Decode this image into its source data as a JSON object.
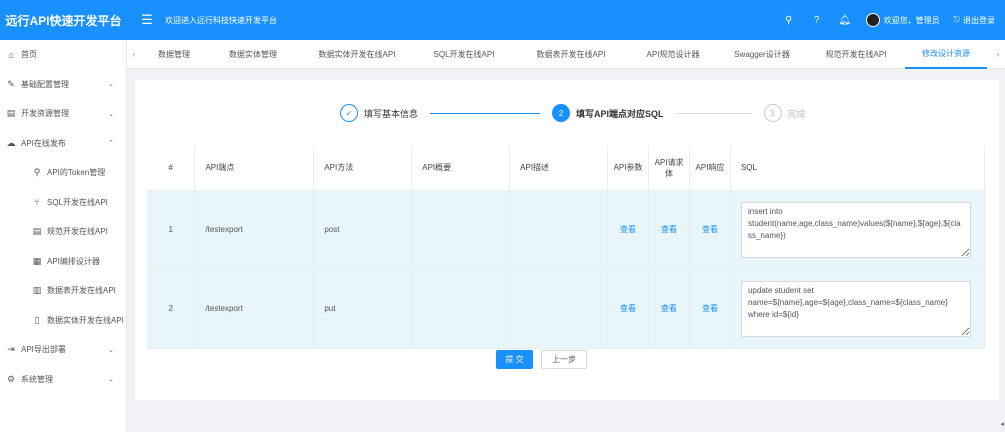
{
  "header": {
    "brand": "远行API快速开发平台",
    "welcome": "欢迎进入远行科技快速开发平台",
    "user_greeting": "欢迎您，管理员",
    "logout": "退出登录",
    "menu_icon": "hamburger-icon",
    "search_icon": "search-icon",
    "help_icon": "help-icon",
    "bell_icon": "bell-icon"
  },
  "sidebar": {
    "items": [
      {
        "label": "首页",
        "icon": "home-icon",
        "sub": false,
        "arrow": ""
      },
      {
        "label": "基础配置管理",
        "icon": "wrench-icon",
        "sub": false,
        "arrow": "⌄"
      },
      {
        "label": "开发资源管理",
        "icon": "document-icon",
        "sub": false,
        "arrow": "⌄"
      },
      {
        "label": "API在线发布",
        "icon": "cloud-icon",
        "sub": false,
        "arrow": "⌃"
      },
      {
        "label": "API的Token管理",
        "icon": "key-icon",
        "sub": true,
        "arrow": ""
      },
      {
        "label": "SQL开发在线API",
        "icon": "fork-icon",
        "sub": true,
        "arrow": ""
      },
      {
        "label": "规范开发在线API",
        "icon": "list-icon",
        "sub": true,
        "arrow": ""
      },
      {
        "label": "API编排设计器",
        "icon": "grid-icon",
        "sub": true,
        "arrow": ""
      },
      {
        "label": "数据表开发在线API",
        "icon": "table-icon",
        "sub": true,
        "arrow": ""
      },
      {
        "label": "数据实体开发在线API",
        "icon": "file-icon",
        "sub": true,
        "arrow": ""
      },
      {
        "label": "API导出部署",
        "icon": "export-icon",
        "sub": false,
        "arrow": "⌄"
      },
      {
        "label": "系统管理",
        "icon": "settings-icon",
        "sub": false,
        "arrow": "⌄"
      }
    ]
  },
  "tabs": {
    "items": [
      {
        "label": "数据管理",
        "active": false
      },
      {
        "label": "数据实体管理",
        "active": false
      },
      {
        "label": "数据实体开发在线API",
        "active": false
      },
      {
        "label": "SQL开发在线API",
        "active": false
      },
      {
        "label": "数据表开发在线API",
        "active": false
      },
      {
        "label": "API规范设计器",
        "active": false
      },
      {
        "label": "Swagger设计器",
        "active": false
      },
      {
        "label": "规范开发在线API",
        "active": false
      },
      {
        "label": "修改设计资源",
        "active": true
      }
    ]
  },
  "steps": {
    "s1": "填写基本信息",
    "s2": "填写API端点对应SQL",
    "s3": "完成",
    "n2": "2",
    "n3": "3",
    "check": "✓"
  },
  "table": {
    "columns": [
      "#",
      "API端点",
      "API方法",
      "API概要",
      "API描述",
      "API参数",
      "API请求体",
      "API响应",
      "SQL"
    ],
    "rows": [
      {
        "index": "1",
        "endpoint": "/testexport",
        "method": "post",
        "summary": "",
        "description": "",
        "params": "查看",
        "body": "查看",
        "response": "查看",
        "sql": "insert into student(name,age,class_name)values(${name},${age},${class_name})"
      },
      {
        "index": "2",
        "endpoint": "/testexport",
        "method": "put",
        "summary": "",
        "description": "",
        "params": "查看",
        "body": "查看",
        "response": "查看",
        "sql": "update student set name=${name},age=${age},class_name=${class_name} where id=${id}"
      }
    ]
  },
  "actions": {
    "submit": "提 交",
    "prev": "上一步"
  },
  "colors": {
    "primary": "#1890ff",
    "row_bg": "#e8f5fb"
  }
}
